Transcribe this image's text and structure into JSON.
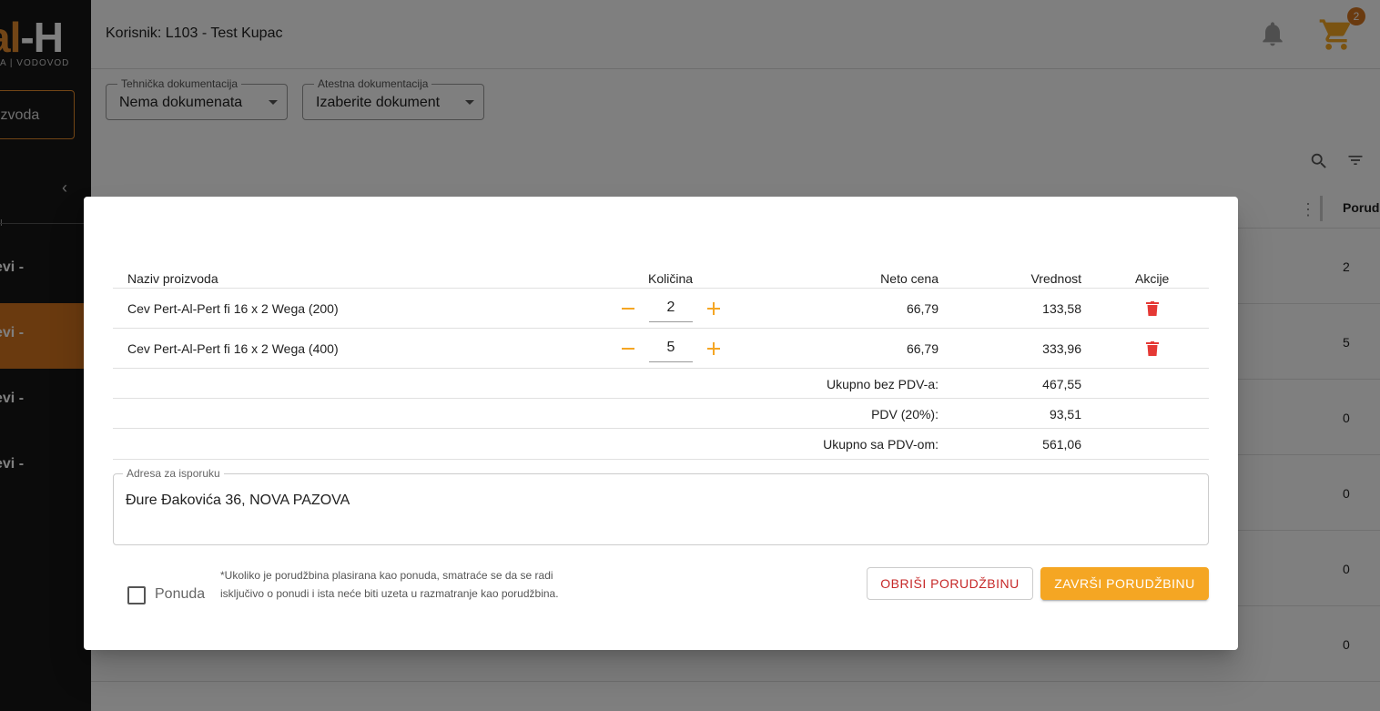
{
  "sidebar": {
    "logo_main": "al",
    "logo_dash": "-H",
    "logo_sub": "A | VODOVOD",
    "search_text": "izvoda",
    "section_marker": "I",
    "items": [
      {
        "label": "evi -"
      },
      {
        "label": "evi -"
      },
      {
        "label": "evi -"
      },
      {
        "label": "evi -"
      }
    ]
  },
  "topbar": {
    "user_label": "Korisnik: L103 - Test Kupac",
    "cart_count": "2"
  },
  "filters": {
    "tech_doc": {
      "label": "Tehnička dokumentacija",
      "value": "Nema dokumenata"
    },
    "atest_doc": {
      "label": "Atestna dokumentacija",
      "value": "Izaberite dokument"
    }
  },
  "background_table": {
    "column_header": "Porud",
    "values": [
      "2",
      "5",
      "0",
      "0",
      "0",
      "0"
    ]
  },
  "modal": {
    "headers": {
      "name": "Naziv proizvoda",
      "qty": "Količina",
      "price": "Neto cena",
      "value": "Vrednost",
      "actions": "Akcije"
    },
    "items": [
      {
        "name": "Cev Pert-Al-Pert fi 16 x 2 Wega (200)",
        "qty": "2",
        "price": "66,79",
        "value": "133,58"
      },
      {
        "name": "Cev Pert-Al-Pert fi 16 x 2 Wega (400)",
        "qty": "5",
        "price": "66,79",
        "value": "333,96"
      }
    ],
    "totals": [
      {
        "label": "Ukupno bez PDV-a:",
        "value": "467,55"
      },
      {
        "label": "PDV (20%):",
        "value": "93,51"
      },
      {
        "label": "Ukupno sa PDV-om:",
        "value": "561,06"
      }
    ],
    "address": {
      "label": "Adresa za isporuku",
      "value": "Đure Đakovića 36, NOVA PAZOVA"
    },
    "offer_checkbox_label": "Ponuda",
    "offer_note": "*Ukoliko je porudžbina plasirana kao ponuda, smatraće se da se radi isključivo o ponudi i ista neće biti uzeta u razmatranje kao porudžbina.",
    "delete_button": "OBRIŠI PORUDŽBINU",
    "finish_button": "ZAVRŠI PORUDŽBINU"
  },
  "colors": {
    "accent": "#f5a623",
    "brand_orange": "#d5741f",
    "delete_red": "#e53935"
  }
}
